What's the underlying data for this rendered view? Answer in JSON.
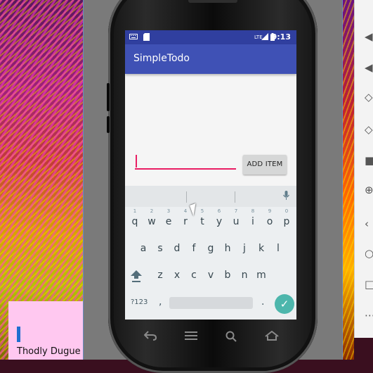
{
  "desktop": {
    "note_text": "Thodly Dugue"
  },
  "phone": {
    "status_bar": {
      "time": "9:13",
      "icons": [
        "keyboard-icon",
        "sim-icon",
        "lte-icon",
        "signal-icon",
        "battery-icon"
      ]
    },
    "app": {
      "title": "SimpleTodo",
      "input_value": "",
      "add_button_label": "ADD ITEM"
    },
    "keyboard": {
      "row1": [
        {
          "k": "q",
          "h": "1"
        },
        {
          "k": "w",
          "h": "2"
        },
        {
          "k": "e",
          "h": "3"
        },
        {
          "k": "r",
          "h": "4"
        },
        {
          "k": "t",
          "h": "5"
        },
        {
          "k": "y",
          "h": "6"
        },
        {
          "k": "u",
          "h": "7"
        },
        {
          "k": "i",
          "h": "8"
        },
        {
          "k": "o",
          "h": "9"
        },
        {
          "k": "p",
          "h": "0"
        }
      ],
      "row2": [
        "a",
        "s",
        "d",
        "f",
        "g",
        "h",
        "j",
        "k",
        "l"
      ],
      "row3": [
        "z",
        "x",
        "c",
        "v",
        "b",
        "n",
        "m"
      ],
      "symbols_label": "?123",
      "comma_label": ",",
      "period_label": ".",
      "enter_icon": "check-icon"
    },
    "nav_icons": [
      "back-icon",
      "menu-icon",
      "search-icon",
      "home-icon"
    ]
  },
  "emulator_panel_icons": [
    "volume-up-icon",
    "volume-down-icon",
    "rotate-left-icon",
    "rotate-right-icon",
    "camera-icon",
    "zoom-icon",
    "back-icon",
    "home-icon",
    "overview-icon",
    "more-icon"
  ],
  "colors": {
    "primary": "#3f51b5",
    "primary_dark": "#303f9f",
    "accent": "#e91e63",
    "enter_key": "#4db6ac"
  }
}
